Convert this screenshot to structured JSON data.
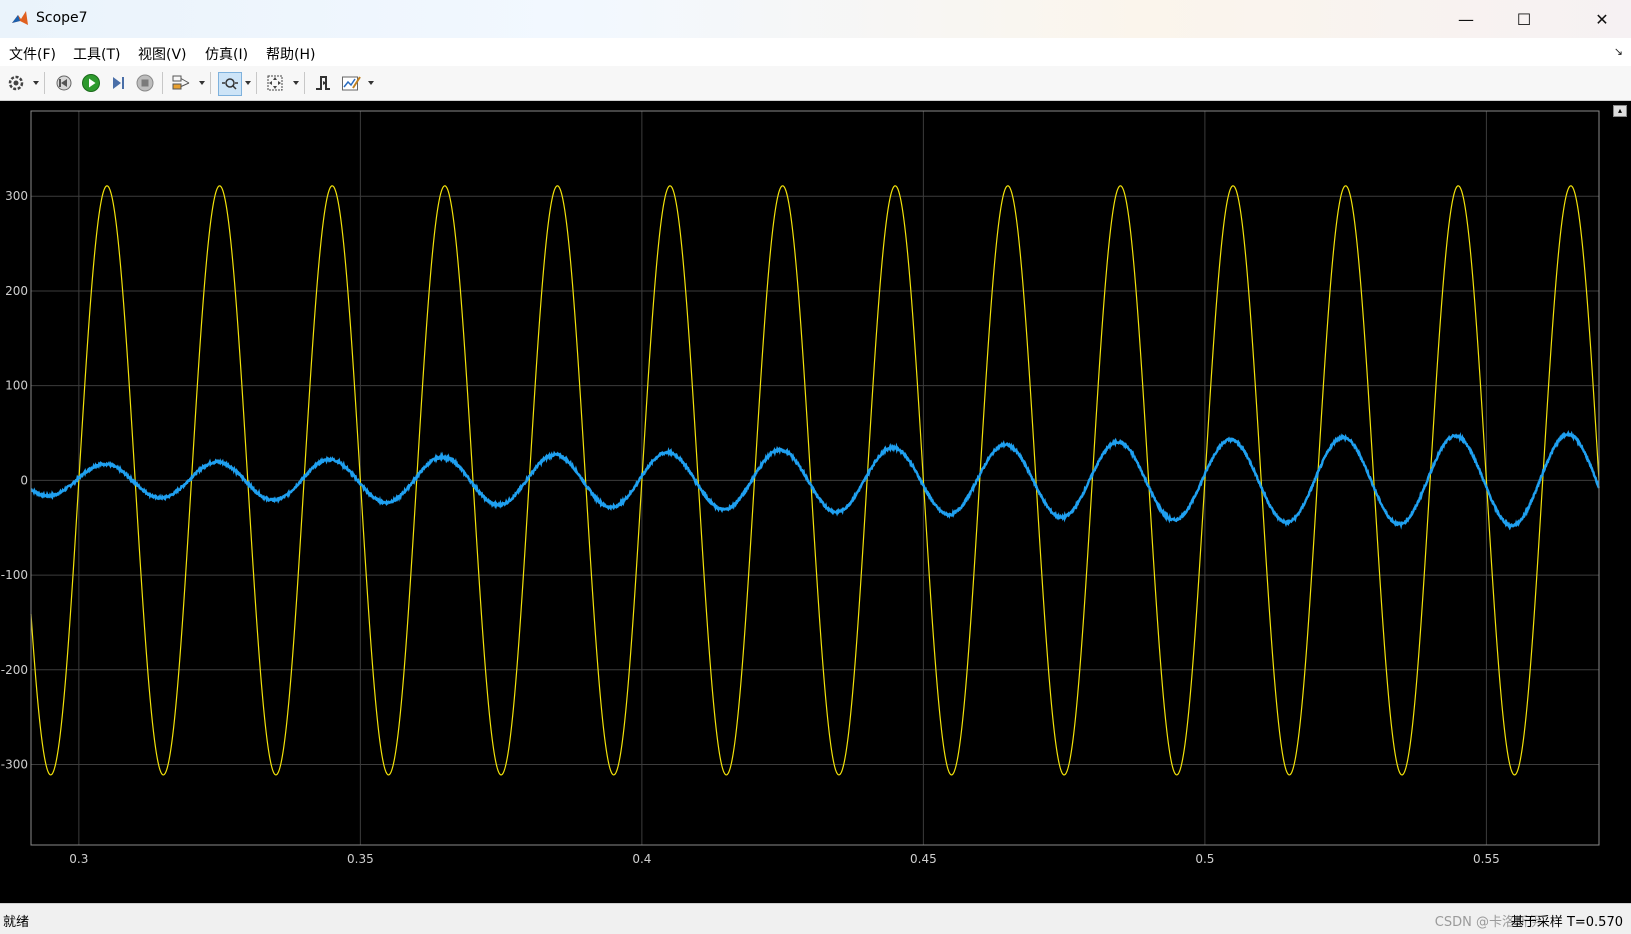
{
  "window": {
    "title": "Scope7",
    "minimize_glyph": "—",
    "maximize_glyph": "☐",
    "close_glyph": "✕"
  },
  "menu": {
    "items": [
      {
        "label": "文件(F)"
      },
      {
        "label": "工具(T)"
      },
      {
        "label": "视图(V)"
      },
      {
        "label": "仿真(I)"
      },
      {
        "label": "帮助(H)"
      }
    ],
    "pin_glyph": "↘"
  },
  "toolbar": {
    "icons": [
      "settings-icon",
      "step-back-icon",
      "run-icon",
      "step-forward-icon",
      "stop-icon",
      "signal-selector-icon",
      "zoom-icon",
      "autoscale-icon",
      "triggers-icon",
      "style-icon"
    ]
  },
  "status": {
    "left": "就绪",
    "right": "基于采样  T=0.570",
    "watermark": "CSDN @卡洛斯伊"
  },
  "colors": {
    "plot_bg": "#000000",
    "grid": "#3c3c3c",
    "axis_text": "#cfcfcf",
    "series_1": "#f2e20a",
    "series_2": "#1fa0f0"
  },
  "chart_data": {
    "type": "line",
    "title": "",
    "xlabel": "",
    "ylabel": "",
    "xlim": [
      0.2915,
      0.57
    ],
    "ylim": [
      -385,
      390
    ],
    "xticks": [
      0.3,
      0.35,
      0.4,
      0.45,
      0.5,
      0.55
    ],
    "xtick_labels": [
      "0.3",
      "0.35",
      "0.4",
      "0.45",
      "0.5",
      "0.55"
    ],
    "yticks": [
      300,
      200,
      100,
      0,
      -100,
      -200,
      -300
    ],
    "ytick_labels": [
      "300",
      "200",
      "100",
      "0",
      "-100",
      "-200",
      "-300"
    ],
    "grid": true,
    "legend": "none",
    "series": [
      {
        "color": "#f2e20a",
        "kind": "sine",
        "amplitude": 311,
        "frequency_hz": 50,
        "peak_times": [
          0.305,
          0.325,
          0.345,
          0.365,
          0.385,
          0.405,
          0.425,
          0.445,
          0.465,
          0.485,
          0.505,
          0.525,
          0.545,
          0.565
        ],
        "trough_times": [
          0.295,
          0.315,
          0.335,
          0.355,
          0.375,
          0.395,
          0.415,
          0.435,
          0.455,
          0.475,
          0.495,
          0.515,
          0.535,
          0.555
        ],
        "start_value": -140
      },
      {
        "color": "#1fa0f0",
        "kind": "growing-sine",
        "frequency_hz": 50,
        "phase_zero_crossing": 0.2995,
        "amplitude_points": [
          {
            "t": 0.2915,
            "a": 16
          },
          {
            "t": 0.32,
            "a": 19
          },
          {
            "t": 0.36,
            "a": 24
          },
          {
            "t": 0.4,
            "a": 29
          },
          {
            "t": 0.44,
            "a": 34
          },
          {
            "t": 0.48,
            "a": 40
          },
          {
            "t": 0.52,
            "a": 45
          },
          {
            "t": 0.57,
            "a": 49
          }
        ]
      }
    ]
  }
}
